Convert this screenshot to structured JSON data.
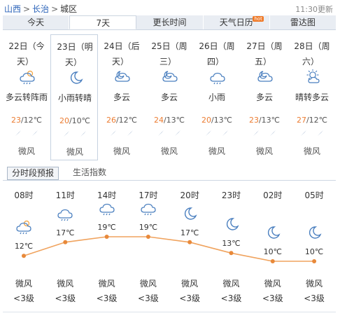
{
  "breadcrumb": [
    "山西",
    "长治",
    "城区"
  ],
  "breadcrumb_sep": ">",
  "update_time": "11:30更新",
  "tabs": [
    {
      "label": "今天",
      "active": false
    },
    {
      "label": "7天",
      "active": true
    },
    {
      "label": "更长时间",
      "active": false
    },
    {
      "label": "天气日历",
      "active": false,
      "badge": "hot"
    },
    {
      "label": "雷达图",
      "active": false
    }
  ],
  "days": [
    {
      "date": "22日（今",
      "phenomenon": "天）",
      "icon": "cloudy-rain-icon",
      "condition": "多云转阵雨",
      "high": "23",
      "low": "/12℃",
      "wind": "微风",
      "selected": false
    },
    {
      "date": "23日（明",
      "phenomenon": "天）",
      "icon": "moon-icon",
      "condition": "小雨转晴",
      "high": "20",
      "low": "/10℃",
      "wind": "微风",
      "selected": true
    },
    {
      "date": "24日（后",
      "phenomenon": "天）",
      "icon": "cloud-moon-icon",
      "condition": "多云",
      "high": "26",
      "low": "/12℃",
      "wind": "微风",
      "selected": false
    },
    {
      "date": "25日（周",
      "phenomenon": "三）",
      "icon": "cloud-moon-icon",
      "condition": "多云",
      "high": "24",
      "low": "/13℃",
      "wind": "微风",
      "selected": false
    },
    {
      "date": "26日（周",
      "phenomenon": "四）",
      "icon": "rain-icon",
      "condition": "小雨",
      "high": "20",
      "low": "/13℃",
      "wind": "微风",
      "selected": false
    },
    {
      "date": "27日（周",
      "phenomenon": "五）",
      "icon": "cloud-moon-icon",
      "condition": "多云",
      "high": "23",
      "low": "/13℃",
      "wind": "微风",
      "selected": false
    },
    {
      "date": "28日（周",
      "phenomenon": "六）",
      "icon": "sun-cloud-icon",
      "condition": "晴转多云",
      "high": "27",
      "low": "/12℃",
      "wind": "微风",
      "selected": false
    }
  ],
  "subtabs": {
    "active": "分时段预报",
    "other": "生活指数"
  },
  "hourly": {
    "times": [
      "08时",
      "11时",
      "14时",
      "17时",
      "20时",
      "23时",
      "02时",
      "05时"
    ],
    "temps": [
      12,
      17,
      19,
      19,
      17,
      13,
      10,
      10
    ],
    "temp_labels": [
      "12℃",
      "17℃",
      "19℃",
      "19℃",
      "17℃",
      "13℃",
      "10℃",
      "10℃"
    ],
    "icons": [
      "cloudy-rain-icon",
      "rain-icon",
      "rain-icon",
      "rain-icon",
      "moon-icon",
      "moon-icon",
      "moon-icon",
      "moon-icon"
    ],
    "wind": [
      "微风",
      "微风",
      "微风",
      "微风",
      "微风",
      "微风",
      "微风",
      "微风"
    ],
    "level": [
      "<3级",
      "<3级",
      "<3级",
      "<3级",
      "<3级",
      "<3级",
      "<3级",
      "<3级"
    ]
  },
  "colors": {
    "line": "#f0a35e",
    "point": "#e8893a",
    "high_temp": "#ec7d33",
    "icon": "#4a7fbf",
    "link": "#2a62b8"
  }
}
